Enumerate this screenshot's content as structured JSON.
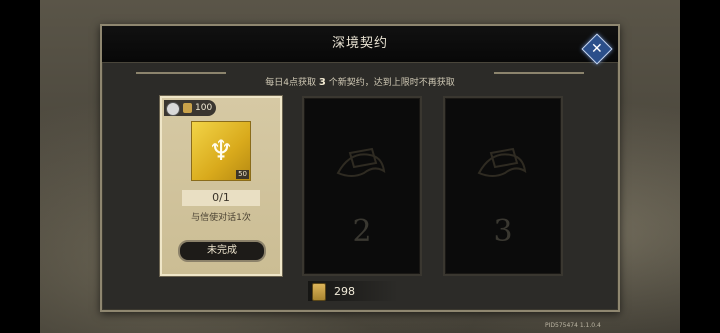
{
  "dialog": {
    "title": "深境契约",
    "info_prefix": "每日4点获取",
    "info_count": "3",
    "info_suffix": "个新契约，达到上限时不再获取",
    "close_icon": "close-icon"
  },
  "contracts": [
    {
      "cost": "100",
      "reward_count": "50",
      "progress": "0/1",
      "task": "与信使对话1次",
      "status": "未完成"
    },
    {
      "slot_number": "2"
    },
    {
      "slot_number": "3"
    }
  ],
  "currency": {
    "value": "298"
  },
  "version": "PID575474 1.1.0.4"
}
